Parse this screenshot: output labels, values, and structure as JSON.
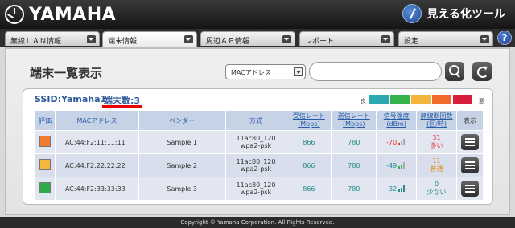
{
  "header": {
    "brand": "YAMAHA",
    "tool_title": "見える化ツール"
  },
  "tabs": [
    {
      "label": "無線ＬＡＮ情報"
    },
    {
      "label": "端末情報"
    },
    {
      "label": "周辺ＡＰ情報"
    },
    {
      "label": "レポート"
    },
    {
      "label": "設定"
    }
  ],
  "help_label": "?",
  "page": {
    "title": "端末一覧表示",
    "search_select": "MACアドレス",
    "search_value": ""
  },
  "summary": {
    "ssid": "SSID:Yamaha1",
    "count": "端末数:3"
  },
  "legend": {
    "good": "良",
    "bad": "悪",
    "colors": [
      "#2aa9b0",
      "#35b24a",
      "#f2b43a",
      "#f26a2a",
      "#d81e3a"
    ]
  },
  "table": {
    "headers": {
      "eval": "評価",
      "mac": "MACアドレス",
      "vendor": "ベンダー",
      "mode": "方式",
      "rx": "受信レート\n(Mbps)",
      "tx": "送信レート\n(Mbps)",
      "signal": "信号強度\n(dBm)",
      "disconnect": "無線断回数\n(回/時)",
      "display": "表示"
    },
    "rows": [
      {
        "eval_color": "#f07a2e",
        "mac": "AC:44:F2:11:11:11",
        "vendor": "Sample 1",
        "mode_1": "11ac80_120",
        "mode_2": "wpa2-psk",
        "rx": "866",
        "tx": "780",
        "signal": "-70",
        "disconnect": "31",
        "disconnect_label": "多い"
      },
      {
        "eval_color": "#f4b63c",
        "mac": "AC:44:F2:22:22:22",
        "vendor": "Sample 2",
        "mode_1": "11ac80_120",
        "mode_2": "wpa2-psk",
        "rx": "866",
        "tx": "780",
        "signal": "-49",
        "disconnect": "11",
        "disconnect_label": "普通"
      },
      {
        "eval_color": "#2eab4a",
        "mac": "AC:44:F2:33:33:33",
        "vendor": "Sample 3",
        "mode_1": "11ac80_120",
        "mode_2": "wpa2-psk",
        "rx": "866",
        "tx": "780",
        "signal": "-32",
        "disconnect": "0",
        "disconnect_label": "少ない"
      }
    ]
  },
  "footer": "Copyright © Yamaha Corporation. All Rights Reserved."
}
